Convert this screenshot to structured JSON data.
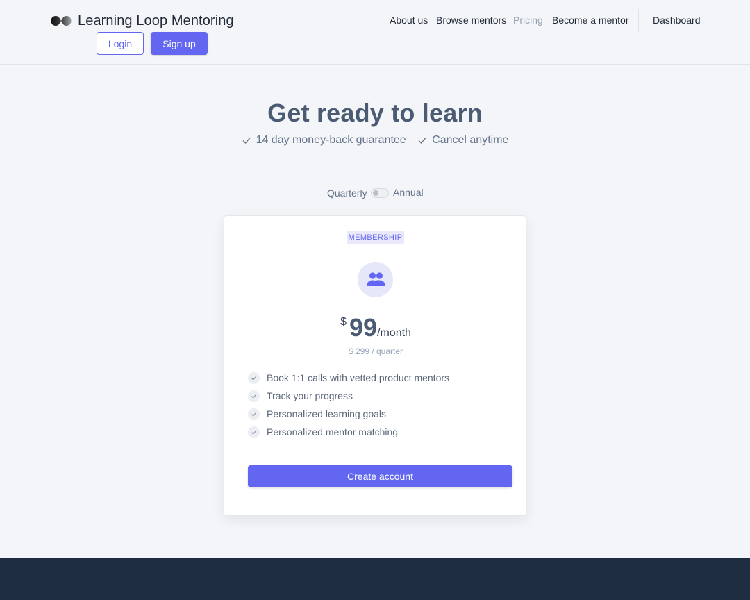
{
  "header": {
    "brand": "Learning Loop Mentoring",
    "login_label": "Login",
    "signup_label": "Sign up",
    "nav": {
      "about": "About us",
      "browse": "Browse mentors",
      "pricing": "Pricing",
      "become": "Become a mentor",
      "dashboard": "Dashboard"
    },
    "active_nav": "pricing"
  },
  "hero": {
    "title": "Get ready to learn",
    "guarantees": [
      "14 day money-back guarantee",
      "Cancel anytime"
    ]
  },
  "billing": {
    "left_label": "Quarterly",
    "right_label": "Annual",
    "annual_selected": false
  },
  "card": {
    "badge": "MEMBERSHIP",
    "icon": "users-icon",
    "currency": "$",
    "amount": "99",
    "period": "/month",
    "subprice": "$ 299 / quarter",
    "features": [
      "Book 1:1 calls with vetted product mentors",
      "Track your progress",
      "Personalized learning goals",
      "Personalized mentor matching"
    ],
    "cta": "Create account"
  },
  "colors": {
    "accent": "#6366f1",
    "footer": "#1f2d40",
    "background": "#f4f5f8"
  }
}
